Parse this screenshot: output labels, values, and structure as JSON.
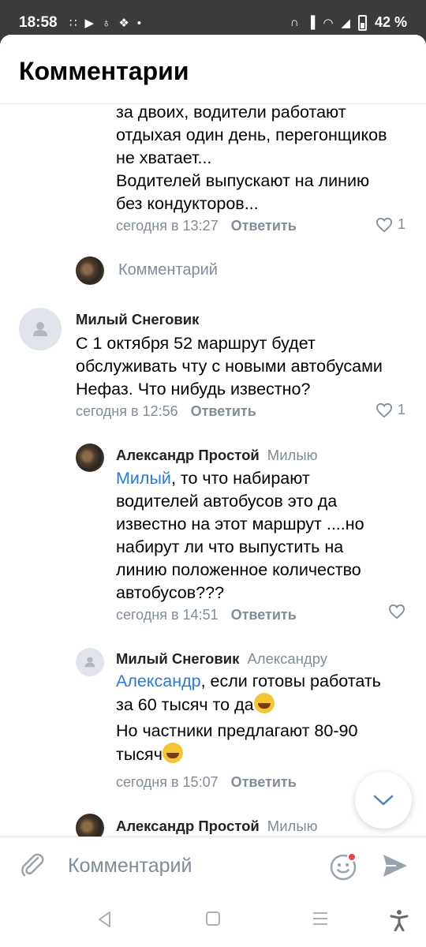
{
  "status_bar": {
    "time": "18:58",
    "battery": "42 %",
    "left_icons": [
      "cast-icon",
      "youtube-icon",
      "ok-icon",
      "vk-icon",
      "dot-icon"
    ],
    "right_icons": [
      "headphones-icon",
      "vibrate-icon",
      "data-icon",
      "wifi-icon",
      "signal-icon",
      "battery-icon"
    ]
  },
  "header": {
    "title": "Комментарии"
  },
  "comments": [
    {
      "text_lines": [
        "за двоих, водители работают",
        "отдыхая один день, перегонщиков",
        "не хватает...",
        "Водителей выпускают на линию",
        "без кондукторов..."
      ],
      "time": "сегодня в 13:27",
      "reply": "Ответить",
      "likes": "1"
    },
    {
      "author": "Милый Снеговик",
      "text_lines": [
        "С 1 октября 52 маршрут будет",
        "обслуживать чту с новыми автобусами",
        "Нефаз. Что нибудь известно?"
      ],
      "time": "сегодня в 12:56",
      "reply": "Ответить",
      "likes": "1"
    },
    {
      "author": "Александр Простой",
      "to": "Милыю",
      "mention": "Милый",
      "text_first": ", то что набирают",
      "text_lines": [
        "водителей автобусов это да",
        "известно на этот маршрут ....но",
        "набирут ли что выпустить на",
        "линию положенное количество",
        "автобусов???"
      ],
      "time": "сегодня в 14:51",
      "reply": "Ответить"
    },
    {
      "author": "Милый Снеговик",
      "to": "Александру",
      "mention": "Александр",
      "text_first": ", если готовы работать",
      "line2": "за 60 тысяч то да",
      "line3": "Но частники предлагают 80-90",
      "line4": "тысяч",
      "time": "сегодня в 15:07",
      "reply": "Ответить"
    },
    {
      "author": "Александр Простой",
      "to": "Милыю"
    }
  ],
  "write_comment": {
    "placeholder": "Комментарий"
  },
  "composer": {
    "placeholder": "Комментарий"
  }
}
